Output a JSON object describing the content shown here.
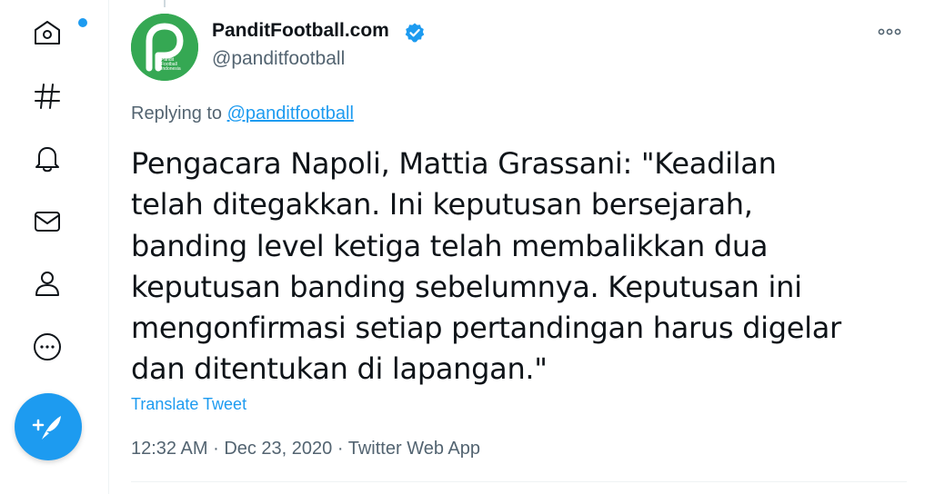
{
  "colors": {
    "accent": "#1d9bf0",
    "text_primary": "#0f1419",
    "text_secondary": "#536471",
    "avatar_green": "#35a853",
    "divider": "#eff3f4"
  },
  "nav": {
    "items": [
      {
        "icon": "home-icon",
        "has_notification_dot": true
      },
      {
        "icon": "hashtag-icon"
      },
      {
        "icon": "bell-icon"
      },
      {
        "icon": "mail-icon"
      },
      {
        "icon": "profile-icon"
      },
      {
        "icon": "more-circle-icon"
      }
    ],
    "compose_icon": "feather-plus-icon"
  },
  "tweet": {
    "author": {
      "display_name": "PanditFootball.com",
      "handle": "@panditfootball",
      "verified": true,
      "avatar_text": "Pandit Football Indonesia"
    },
    "replying_to_prefix": "Replying to",
    "replying_to_handle": "@panditfootball",
    "text": "Pengacara Napoli, Mattia Grassani: \"Keadilan telah ditegakkan. Ini keputusan bersejarah, banding level ketiga telah membalikkan dua keputusan banding sebelumnya. Keputusan ini mengonfirmasi setiap pertandingan harus digelar dan ditentukan di lapangan.\"",
    "translate_label": "Translate Tweet",
    "time": "12:32 AM",
    "date": "Dec 23, 2020",
    "source": "Twitter Web App",
    "separator": "·"
  }
}
